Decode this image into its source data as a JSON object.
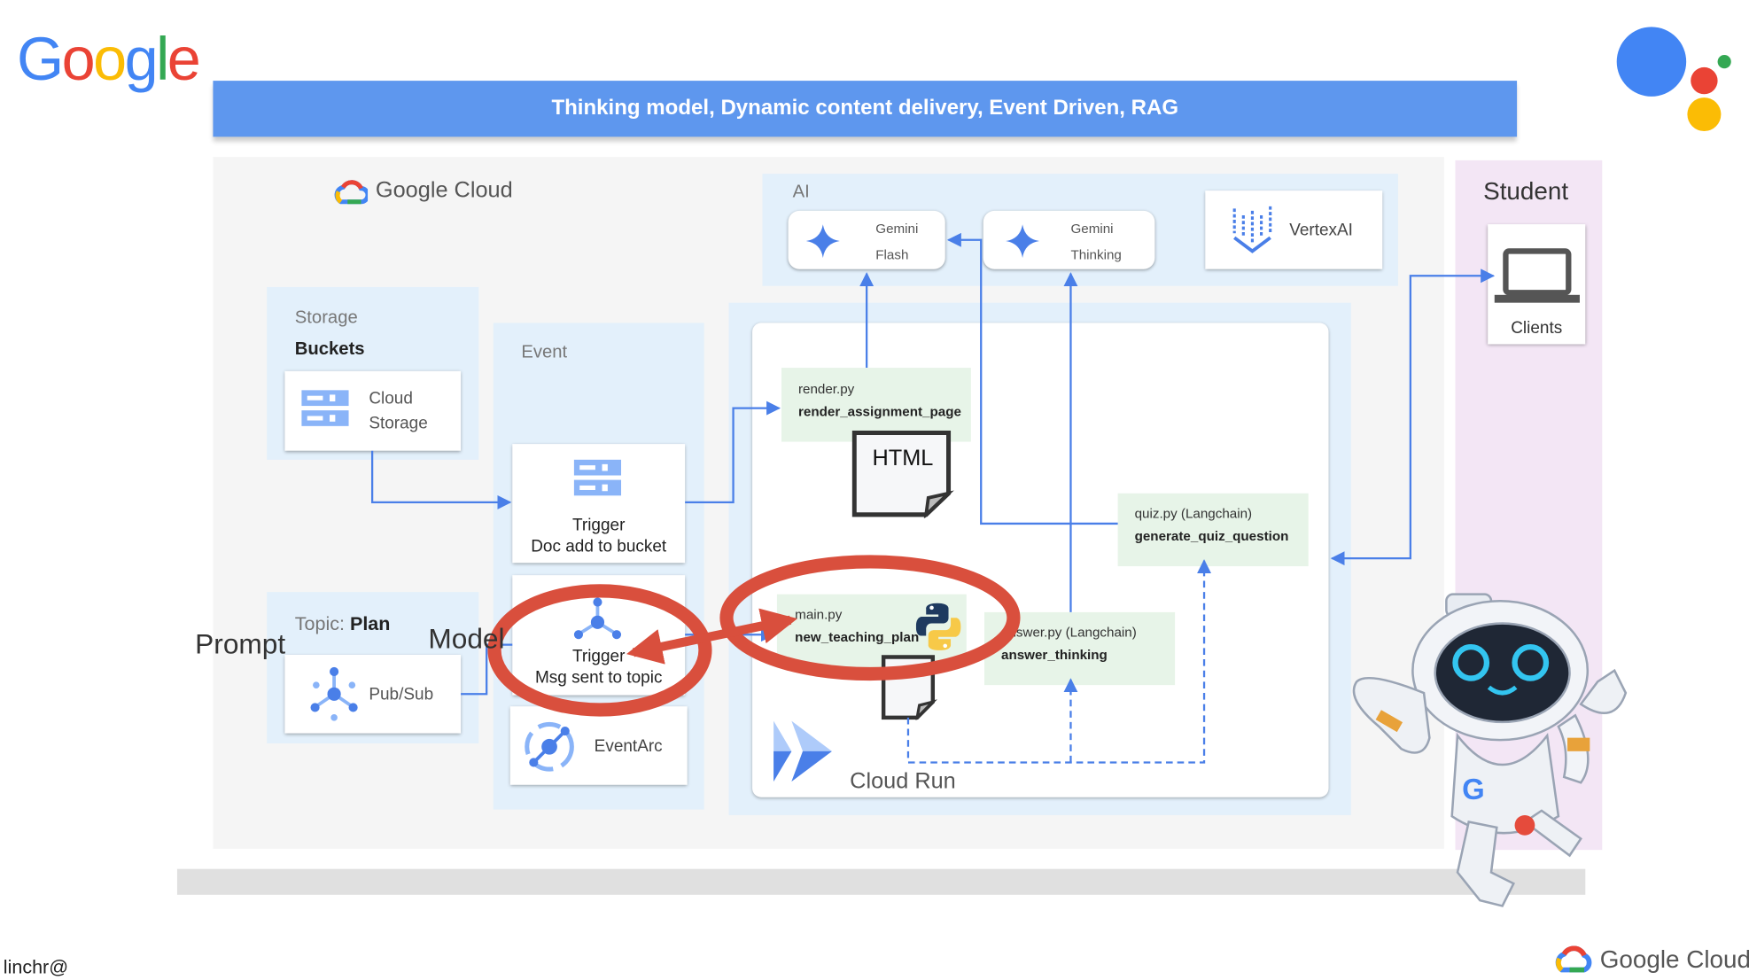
{
  "logo_top_left": "Google",
  "banner": {
    "title": "Thinking model, Dynamic content delivery, Event Driven, RAG"
  },
  "gcp_label": "Google Cloud",
  "ai": {
    "label": "AI",
    "gemini_flash": [
      "Gemini",
      "Flash"
    ],
    "gemini_thinking": [
      "Gemini",
      "Thinking"
    ],
    "vertex": "VertexAI"
  },
  "storage": {
    "label": "Storage",
    "sublabel": "Buckets",
    "card": [
      "Cloud",
      "Storage"
    ]
  },
  "topic": {
    "prefix": "Topic: ",
    "name": "Plan",
    "card": "Pub/Sub"
  },
  "event": {
    "label": "Event",
    "trigger1": [
      "Trigger",
      "Doc add to bucket"
    ],
    "trigger2": [
      "Trigger",
      "Msg sent to topic"
    ],
    "eventarc": "EventArc"
  },
  "cloud_run": {
    "label": "Cloud Run",
    "render": {
      "file": "render.py",
      "func": "render_assignment_page",
      "doc": "HTML"
    },
    "quiz": {
      "file": "quiz.py (Langchain)",
      "func": "generate_quiz_question"
    },
    "main": {
      "file": "main.py",
      "func": "new_teaching_plan"
    },
    "answer": {
      "file": "answer.py (Langchain)",
      "func": "answer_thinking"
    }
  },
  "student": {
    "label": "Student",
    "clients": "Clients"
  },
  "annotations": {
    "prompt": "Prompt",
    "model": "Model"
  },
  "footer": {
    "author": "linchr@",
    "brand": "Google Cloud"
  },
  "colors": {
    "banner": "#5e97ee",
    "line": "#4a7fe8",
    "annotation": "#d94f3d",
    "area": "#e3f0fb",
    "code_box": "#e7f4e8",
    "student_panel": "#f3e6f5"
  }
}
